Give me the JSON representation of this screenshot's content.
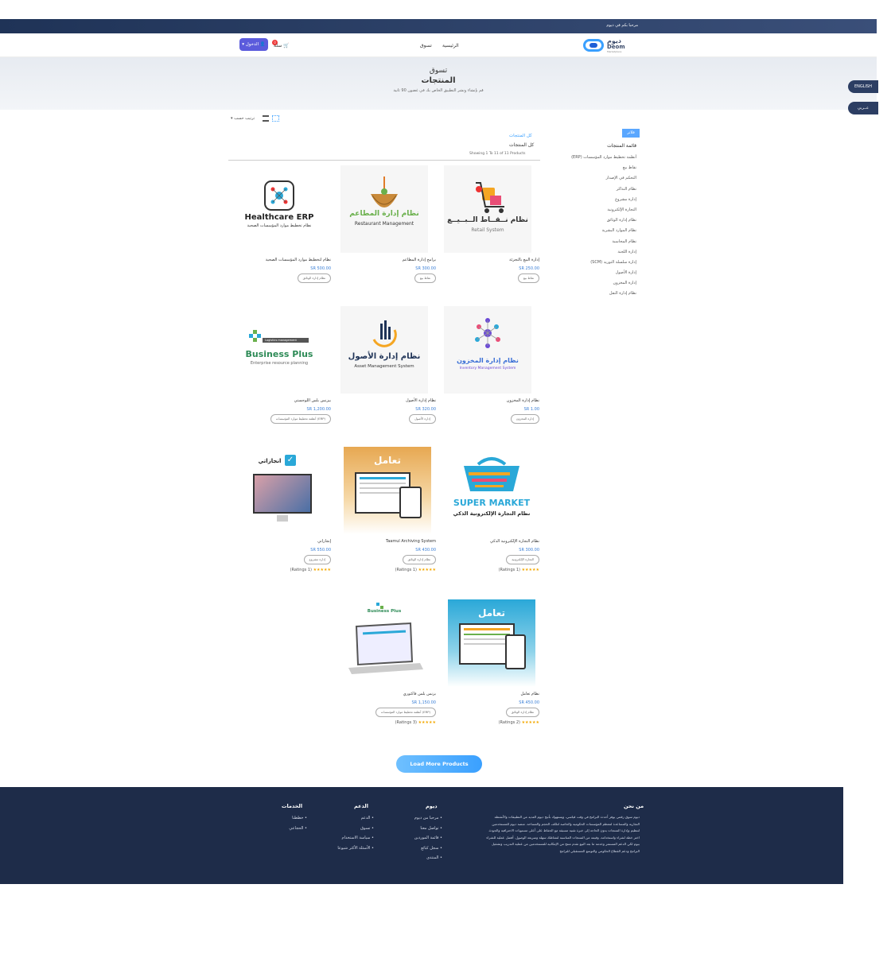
{
  "topbar": {
    "welcome": "مرحبا بكم في ديوم"
  },
  "header": {
    "logo_ar": "ديوم",
    "logo_en": "Deom",
    "logo_sub": "Marketplace",
    "nav_home": "الرئيسية",
    "nav_market": "تسوق",
    "cart_label": "سلة",
    "cart_count": "0",
    "login": "الدخول"
  },
  "hero": {
    "title1": "تسوق",
    "title2": "المنتجات",
    "subtitle": "قم بإنشاء ونشر التطبيق الخاص بك في غضون 90 ثانية"
  },
  "lang": {
    "english": "ENGLISH",
    "arabic": "عــربي"
  },
  "filters": {
    "button": "فلاتر",
    "heading": "قائمة المنتجات",
    "items": [
      "أنظمة تخطيط موارد المؤسسات (ERP)",
      "نقاط بيع",
      "التحكم في الإصدار",
      "نظام التذاكر",
      "إدارة مشروع",
      "التجارة الإلكترونية",
      "نظام إدارة الوثائق",
      "نظام الموارد البشرية",
      "نظام المحاسبة",
      "إدارة اللجنة",
      "إدارة سلسلة التوريد (SCM)",
      "إدارة الأصول",
      "إدارة المخزون",
      "نظام إدارة النقل"
    ]
  },
  "toolbar": {
    "sort": "ترتيب حسب"
  },
  "breadcrumb": {
    "link": "كل المنتجات",
    "current": "كل المنتجات"
  },
  "showing": "Showing 1 To 11 of 11 Products",
  "products": [
    {
      "name": "إدارة البيع بالتجزئة",
      "price": "SR 250.00",
      "tag": "نقاط بيع",
      "stars": "",
      "ratings": ""
    },
    {
      "name": "برامج إدارة المطاعم",
      "price": "SR 300.00",
      "tag": "نقاط بيع",
      "stars": "",
      "ratings": ""
    },
    {
      "name": "نظام لتخطيط موارد المؤسسات الصحية",
      "price": "SR 500.00",
      "tag": "نظام إدارة الوثائق",
      "stars": "",
      "ratings": ""
    },
    {
      "name": "نظام إدارة المخزون",
      "price": "SR 1.00",
      "tag": "إدارة المخزون",
      "stars": "",
      "ratings": ""
    },
    {
      "name": "نظام إدارة الأصول",
      "price": "SR 320.00",
      "tag": "إدارة الأصول",
      "stars": "",
      "ratings": ""
    },
    {
      "name": "بيزنس بلس اللوجستي",
      "price": "SR 1,200.00",
      "tag": "أنظمة تخطيط موارد المؤسسات (ERP)",
      "stars": "",
      "ratings": ""
    },
    {
      "name": "نظام التجارة الإلكترونية الذكي",
      "price": "SR 300.00",
      "tag": "التجارة الإلكترونية",
      "stars": "★★★★★",
      "ratings": "(Ratings 1)"
    },
    {
      "name": "Taamul Archiving System",
      "price": "SR 430.00",
      "tag": "نظام إدارة الوثائق",
      "stars": "★★★★★",
      "ratings": "(Ratings 1)"
    },
    {
      "name": "إنجازاتي",
      "price": "SR 550.00",
      "tag": "إدارة مشروع",
      "stars": "★★★★★",
      "ratings": "(Ratings 1)"
    },
    {
      "name": "نظام تعامل",
      "price": "SR 450.00",
      "tag": "نظام إدارة الوثائق",
      "stars": "★★★★★",
      "ratings": "(Ratings 2)"
    },
    {
      "name": "بزنس بلس فاكتوري",
      "price": "SR 1,150.00",
      "tag": "أنظمة تخطيط موارد المؤسسات (ERP)",
      "stars": "★★★★★",
      "ratings": "(Ratings 3)"
    }
  ],
  "art": {
    "retail_ar": "نظام نــقــاط الــبــيــع",
    "retail_en": "Retail System",
    "restaurant_ar": "نظام إدارة المطاعم",
    "restaurant_en": "Restaurant Management",
    "health_en": "Healthcare ERP",
    "health_ar": "نظام تخطيط موارد المؤسسات الصحية",
    "inventory_ar": "نظام إدارة المخزون",
    "inventory_en": "Inventory Management System",
    "asset_ar": "نظام إدارة الأصول",
    "asset_en": "Asset Management System",
    "bp_tag": "Logistics management",
    "bp_title": "Business Plus",
    "bp_sub": "Enterprise resource planning",
    "super_en": "SUPER MARKET",
    "super_ar": "نظام التجارة الإلكترونية الذكي",
    "taamul": "تعامل",
    "injazati": "انجازاتي",
    "bp2": "Business Plus"
  },
  "load_more": "Load More Products",
  "footer": {
    "about_title": "من نحن",
    "about_text": "ديوم سوق رقمي يوفر أحدث البرامج في وقت قياسي، ويستهوك بأتيح ديوم العديد من التطبيقات والأنشطة التجارية والمساعدة لمعظم المؤسسات الحكومية والخاصة لتلكف الحجم والمساحة. منصة ديوم للمستخدمين لتنظيم وإدارة المنتجات بدون الحاجة إلى خبرة تقنية مسبقة مع الحفاظ على أعلى مستويات الاحترافية والجودة. اختر خطة لشراء واستخدامه. وقيمة من المنتجات المناسبة لنشاطك سهلة وسريعة الوصول. أفضل عملية للشراء بيوم لكي الدعم المستمر وخدمة ما بعد البيع تقدم منتج من الإمكانية للمستخدمين من عملية التدريب وتشغيل البرامج ودعم القطاع الحكومي والتوسع المستقبلي للبرامج",
    "deom_title": "ديوم",
    "deom_items": [
      "مرحبا من ديوم",
      "تواصل معنا",
      "قائمة الموردين",
      "سجل كبائع",
      "المنتدى"
    ],
    "support_title": "الدعم",
    "support_items": [
      "الدعم",
      "تسوق",
      "سياسة الاستخدام",
      "الأسئلة الأكثر شيوعا"
    ],
    "services_title": "الخدمات",
    "services_items": [
      "خططنا",
      "الحجاعي"
    ]
  }
}
